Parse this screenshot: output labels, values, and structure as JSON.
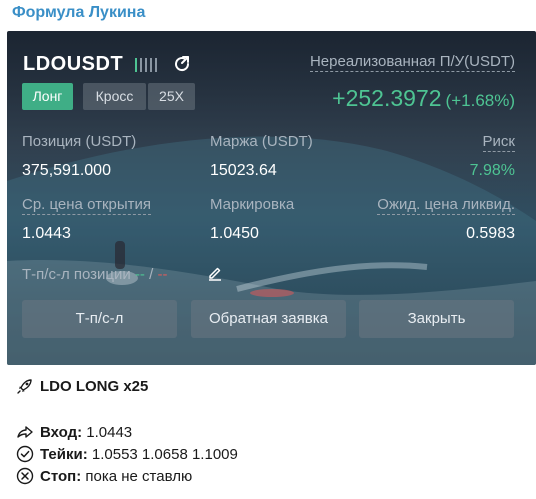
{
  "channel": {
    "name": "Формула Лукина"
  },
  "card": {
    "symbol": "LDOUSDT",
    "tags": {
      "side": "Лонг",
      "margin_mode": "Кросс",
      "leverage": "25X"
    },
    "pnl": {
      "label": "Нереализованная П/У(USDT)",
      "value": "+252.3972",
      "percent": "(+1.68%)"
    },
    "stats": {
      "position": {
        "label": "Позиция (USDT)",
        "value": "375,591.000"
      },
      "margin": {
        "label": "Маржа (USDT)",
        "value": "15023.64"
      },
      "risk": {
        "label": "Риск",
        "value": "7.98%"
      },
      "avg_entry": {
        "label": "Ср. цена открытия",
        "value": "1.0443"
      },
      "mark": {
        "label": "Маркировка",
        "value": "1.0450"
      },
      "liq": {
        "label": "Ожид. цена ликвид.",
        "value": "0.5983"
      }
    },
    "tpsl": {
      "label": "Т-п/с-л позиции",
      "tp": "--",
      "sep": "/",
      "sl": "--"
    },
    "buttons": {
      "tpsl": "Т-п/с-л",
      "reverse": "Обратная заявка",
      "close": "Закрыть"
    }
  },
  "message": {
    "title": "LDO LONG x25",
    "entry": {
      "label": "Вход:",
      "value": "1.0443"
    },
    "takes": {
      "label": "Тейки:",
      "value": "1.0553 1.0658 1.1009"
    },
    "stop": {
      "label": "Стоп:",
      "value": "пока не ставлю"
    }
  },
  "colors": {
    "green": "#4ec493",
    "red": "#d45d5d",
    "channel": "#3a8fc7"
  }
}
